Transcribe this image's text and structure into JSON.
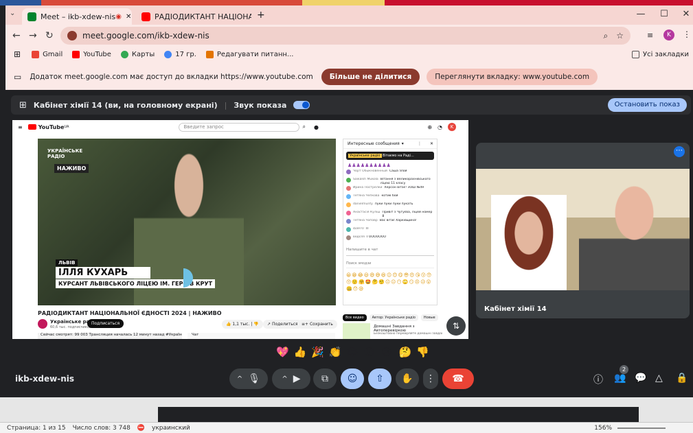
{
  "browser": {
    "tabs": [
      {
        "label": "Meet – ikb-xdew-nis",
        "color": "#00832d"
      },
      {
        "label": "РАДІОДИКТАНТ НАЦІОНА",
        "color": "#ff0000"
      }
    ],
    "new_tab": "+",
    "url": "meet.google.com/ikb-xdew-nis",
    "profile_initial": "K",
    "bookmarks": [
      "Gmail",
      "YouTube",
      "Карты",
      "17 гр.",
      "Редагувати питанн..."
    ],
    "all_bookmarks": "Усі закладки",
    "share_notice": "Додаток meet.google.com має доступ до вкладки https://www.youtube.com",
    "stop_share_btn": "Більше не ділитися",
    "view_tab_btn": "Переглянути вкладку: www.youtube.com"
  },
  "meet": {
    "presenting_label": "Кабінет хімії 14 (ви, на головному екрані)",
    "sound_label": "Звук показа",
    "stop_presenting": "Остановить показ",
    "tile_name": "Кабінет хімії 14",
    "meeting_code": "ikb-xdew-nis",
    "people_count": "2",
    "reactions": [
      "💖",
      "👍",
      "🎉",
      "👏",
      "😂",
      "😮",
      "😢",
      "🤔",
      "👎"
    ]
  },
  "youtube": {
    "search_placeholder": "Введите запрос",
    "brand": "YouTube",
    "brand_sup": "UA",
    "avatar": "K",
    "channel_badge_line1": "УКРАЇНСЬКЕ",
    "channel_badge_line2": "РАДІО",
    "live": "НАЖИВО",
    "city": "ЛЬВІВ",
    "name": "ІЛЛЯ КУХАРЬ",
    "subtitle": "КУРСАНТ ЛЬВІВСЬКОГО ЛІЦЕЮ ІМ. ГЕРОЇВ КРУТ",
    "video_title": "РАДІОДИКТАНТ НАЦІОНАЛЬНОЇ ЄДНОСТІ 2024 | НАЖИВО",
    "channel": "Українське радіо",
    "subs": "60,6 тыс. подписчиков",
    "subscribe": "Подписаться",
    "likes": "1,1 тыс.",
    "share": "Поделиться",
    "save": "Сохранить",
    "viewing": "Сейчас смотрят: 99 003  Трансляция началась 12 минут назад  #УкраїнськеРадіо #Пос",
    "chat_tab": "Чат",
    "chat_title": "Интересные сообщения",
    "pinned_channel": "Українське радіо",
    "pinned_text": "Вітаємо на Раді...",
    "chat": [
      {
        "user": "Чорт Обыкновенный",
        "text": "Саша злой"
      },
      {
        "user": "Saikalsh Mukola",
        "text": "Вітання з Великорахнівського ліцею 11 класу"
      },
      {
        "user": "Ирина Пострелки",
        "text": "Херсон вітає! ЗОШ №49"
      },
      {
        "user": "Тетяна Чепкова",
        "text": "котик бой"
      },
      {
        "user": "danielmunty",
        "text": "пуки пуки пуки пукать"
      },
      {
        "user": "Анастасія Куліш",
        "text": "Привіт з Чугуєва, ліцей номер 8"
      },
      {
        "user": "Тетяна Чоповр",
        "text": "Вас вітає Харківщина!"
      },
      {
        "user": "iba970",
        "text": "П"
      },
      {
        "user": "ведєля",
        "text": "ГООООООО"
      }
    ],
    "chat_input": "Напишите в чат",
    "emoji_search": "Поиск эмодзи",
    "rec_chips": [
      "Все видео",
      "Автор: Українське радіо",
      "Новые"
    ],
    "rec_title": "Домашні Завдання з Автоперевіркою",
    "rec_sub": "Безкоштовно перевіряйте домашні завдання"
  },
  "word": {
    "page": "Страница: 1 из 15",
    "words": "Число слов: 3 748",
    "lang": "украинский",
    "zoom": "156%"
  },
  "colors": {
    "meet_bg": "#202124",
    "stop_share": "#8b3a2e",
    "hangup": "#ea4335",
    "accent": "#a8c7fa"
  }
}
